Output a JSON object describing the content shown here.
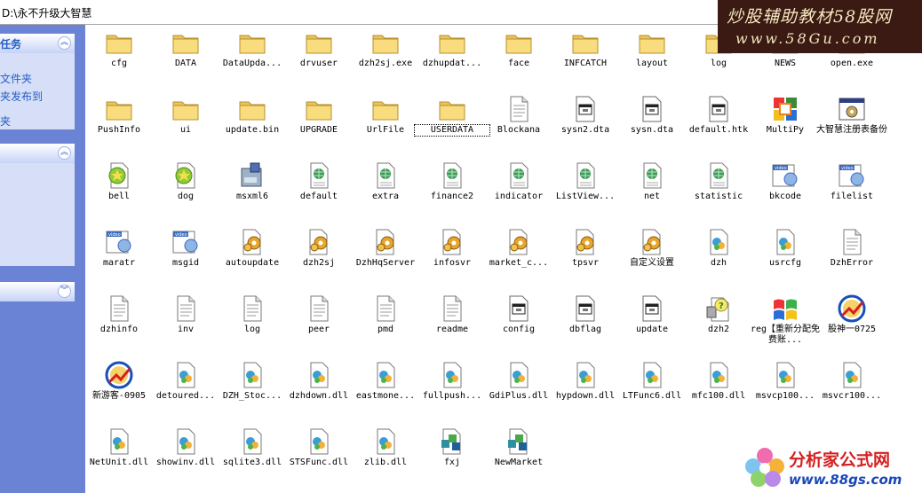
{
  "address": {
    "text": "D:\\永不升级大智慧"
  },
  "banner_top": {
    "line1": "炒股辅助教材58股网",
    "line2": "www.58Gu.com"
  },
  "banner_bottom": {
    "line1": "分析家公式网",
    "line2": "www.88gs.com"
  },
  "sidebar": {
    "panel1": {
      "title": "任务",
      "items": [
        "文件夹",
        "夹发布到",
        "夹"
      ]
    },
    "panel2": {
      "title": ""
    },
    "panel3": {
      "title": ""
    }
  },
  "files": [
    {
      "name": "cfg",
      "icon": "folder"
    },
    {
      "name": "DATA",
      "icon": "folder"
    },
    {
      "name": "DataUpda...",
      "icon": "folder"
    },
    {
      "name": "drvuser",
      "icon": "folder"
    },
    {
      "name": "dzh2sj.exe",
      "icon": "folder"
    },
    {
      "name": "dzhupdat...",
      "icon": "folder"
    },
    {
      "name": "face",
      "icon": "folder"
    },
    {
      "name": "INFCATCH",
      "icon": "folder"
    },
    {
      "name": "layout",
      "icon": "folder"
    },
    {
      "name": "log",
      "icon": "folder"
    },
    {
      "name": "NEWS",
      "icon": "folder"
    },
    {
      "name": "open.exe",
      "icon": "folder"
    },
    {
      "name": "PushInfo",
      "icon": "folder"
    },
    {
      "name": "ui",
      "icon": "folder"
    },
    {
      "name": "update.bin",
      "icon": "folder"
    },
    {
      "name": "UPGRADE",
      "icon": "folder"
    },
    {
      "name": "UrlFile",
      "icon": "folder"
    },
    {
      "name": "USERDATA",
      "icon": "folder",
      "selected": true
    },
    {
      "name": "Blockana",
      "icon": "doc"
    },
    {
      "name": "sysn2.dta",
      "icon": "window"
    },
    {
      "name": "sysn.dta",
      "icon": "window"
    },
    {
      "name": "default.htk",
      "icon": "window"
    },
    {
      "name": "MultiPy",
      "icon": "multipy"
    },
    {
      "name": "大智慧注册表备份",
      "icon": "gearwindow"
    },
    {
      "name": "bell",
      "icon": "greenstar"
    },
    {
      "name": "dog",
      "icon": "greenstar"
    },
    {
      "name": "msxml6",
      "icon": "installer"
    },
    {
      "name": "default",
      "icon": "globe"
    },
    {
      "name": "extra",
      "icon": "globe"
    },
    {
      "name": "finance2",
      "icon": "globe"
    },
    {
      "name": "indicator",
      "icon": "globe"
    },
    {
      "name": "ListView...",
      "icon": "globe"
    },
    {
      "name": "net",
      "icon": "globe"
    },
    {
      "name": "statistic",
      "icon": "globe"
    },
    {
      "name": "bkcode",
      "icon": "video"
    },
    {
      "name": "filelist",
      "icon": "video"
    },
    {
      "name": "maratr",
      "icon": "video"
    },
    {
      "name": "msgid",
      "icon": "video"
    },
    {
      "name": "autoupdate",
      "icon": "gear"
    },
    {
      "name": "dzh2sj",
      "icon": "gear"
    },
    {
      "name": "DzhHqServer",
      "icon": "gear"
    },
    {
      "name": "infosvr",
      "icon": "gear"
    },
    {
      "name": "market_c...",
      "icon": "gear"
    },
    {
      "name": "tpsvr",
      "icon": "gear"
    },
    {
      "name": "自定义设置",
      "icon": "gear"
    },
    {
      "name": "dzh",
      "icon": "dll"
    },
    {
      "name": "usrcfg",
      "icon": "dll"
    },
    {
      "name": "DzhError",
      "icon": "doc"
    },
    {
      "name": "dzhinfo",
      "icon": "doc"
    },
    {
      "name": "inv",
      "icon": "doc"
    },
    {
      "name": "log",
      "icon": "doc"
    },
    {
      "name": "peer",
      "icon": "doc"
    },
    {
      "name": "pmd",
      "icon": "doc"
    },
    {
      "name": "readme",
      "icon": "doc"
    },
    {
      "name": "config",
      "icon": "window"
    },
    {
      "name": "dbflag",
      "icon": "window"
    },
    {
      "name": "update",
      "icon": "window"
    },
    {
      "name": "dzh2",
      "icon": "help"
    },
    {
      "name": "reg【重新分配免费账...",
      "icon": "winflag"
    },
    {
      "name": "股神一0725",
      "icon": "chartlogo"
    },
    {
      "name": "新游客-0905",
      "icon": "chartlogo"
    },
    {
      "name": "detoured...",
      "icon": "dll"
    },
    {
      "name": "DZH_Stoc...",
      "icon": "dll"
    },
    {
      "name": "dzhdown.dll",
      "icon": "dll"
    },
    {
      "name": "eastmone...",
      "icon": "dll"
    },
    {
      "name": "fullpush...",
      "icon": "dll"
    },
    {
      "name": "GdiPlus.dll",
      "icon": "dll"
    },
    {
      "name": "hypdown.dll",
      "icon": "dll"
    },
    {
      "name": "LTFunc6.dll",
      "icon": "dll"
    },
    {
      "name": "mfc100.dll",
      "icon": "dll"
    },
    {
      "name": "msvcp100...",
      "icon": "dll"
    },
    {
      "name": "msvcr100...",
      "icon": "dll"
    },
    {
      "name": "NetUnit.dll",
      "icon": "dll"
    },
    {
      "name": "showinv.dll",
      "icon": "dll"
    },
    {
      "name": "sqlite3.dll",
      "icon": "dll"
    },
    {
      "name": "STSFunc.dll",
      "icon": "dll"
    },
    {
      "name": "zlib.dll",
      "icon": "dll"
    },
    {
      "name": "fxj",
      "icon": "cubes"
    },
    {
      "name": "NewMarket",
      "icon": "cubes"
    }
  ]
}
